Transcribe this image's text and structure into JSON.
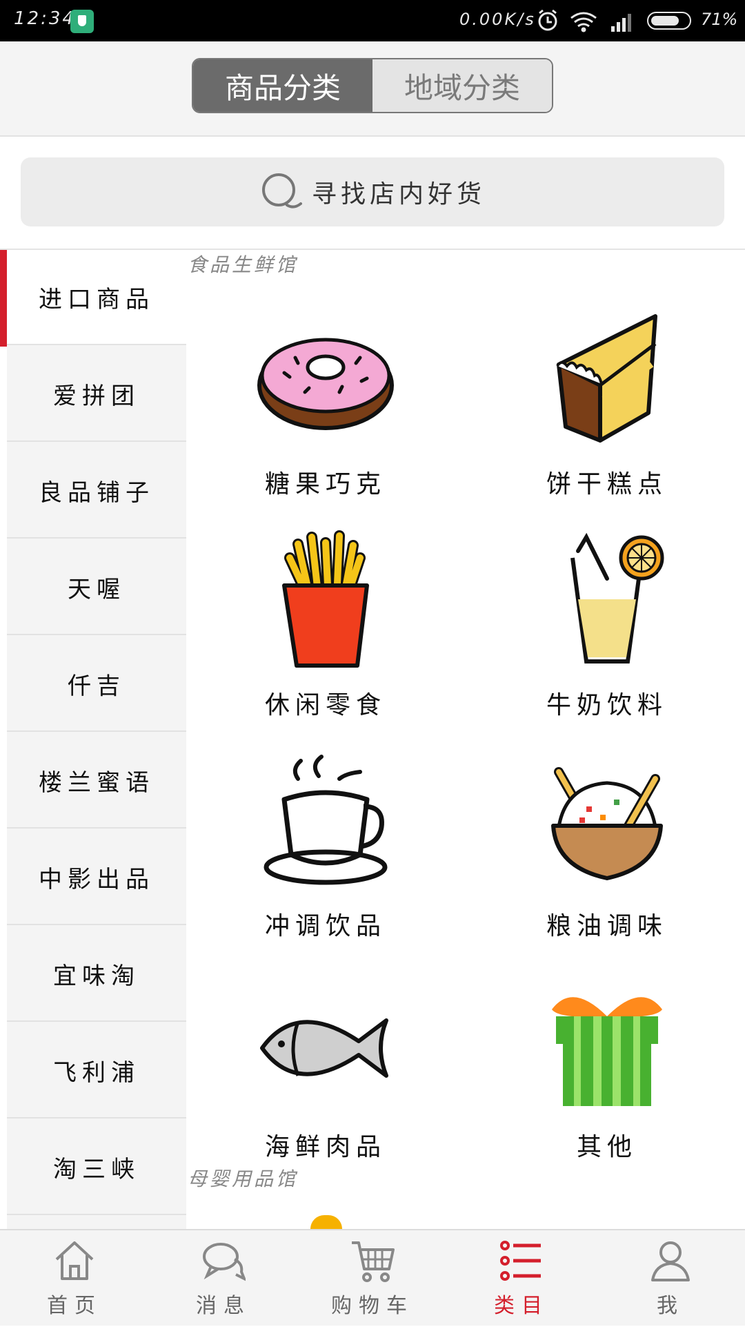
{
  "status_bar": {
    "time": "12:34",
    "net_speed": "0.00K/s",
    "battery": "71%"
  },
  "header": {
    "tabs": [
      {
        "label": "商品分类",
        "active": true
      },
      {
        "label": "地域分类",
        "active": false
      }
    ]
  },
  "search": {
    "placeholder": "寻找店内好货"
  },
  "sidebar": {
    "items": [
      {
        "label": "进口商品",
        "active": true
      },
      {
        "label": "爱拼团"
      },
      {
        "label": "良品铺子"
      },
      {
        "label": "天喔"
      },
      {
        "label": "仟吉"
      },
      {
        "label": "楼兰蜜语"
      },
      {
        "label": "中影出品"
      },
      {
        "label": "宜味淘"
      },
      {
        "label": "飞利浦"
      },
      {
        "label": "淘三峡"
      }
    ]
  },
  "sections": [
    {
      "title": "食品生鲜馆",
      "items": [
        {
          "label": "糖果巧克",
          "icon": "donut-icon"
        },
        {
          "label": "饼干糕点",
          "icon": "cake-icon"
        },
        {
          "label": "休闲零食",
          "icon": "fries-icon"
        },
        {
          "label": "牛奶饮料",
          "icon": "drink-icon"
        },
        {
          "label": "冲调饮品",
          "icon": "coffee-cup-icon"
        },
        {
          "label": "粮油调味",
          "icon": "rice-bowl-icon"
        },
        {
          "label": "海鲜肉品",
          "icon": "fish-icon"
        },
        {
          "label": "其他",
          "icon": "gift-icon"
        }
      ]
    },
    {
      "title": "母婴用品馆"
    }
  ],
  "bottom_nav": [
    {
      "label": "首页",
      "icon": "home-icon"
    },
    {
      "label": "消息",
      "icon": "message-icon"
    },
    {
      "label": "购物车",
      "icon": "cart-icon"
    },
    {
      "label": "类目",
      "icon": "list-icon",
      "active": true
    },
    {
      "label": "我",
      "icon": "user-icon"
    }
  ],
  "colors": {
    "accent": "#d41f2c",
    "segment_active": "#6b6b6b",
    "sidebar_bg": "#f4f4f4"
  }
}
